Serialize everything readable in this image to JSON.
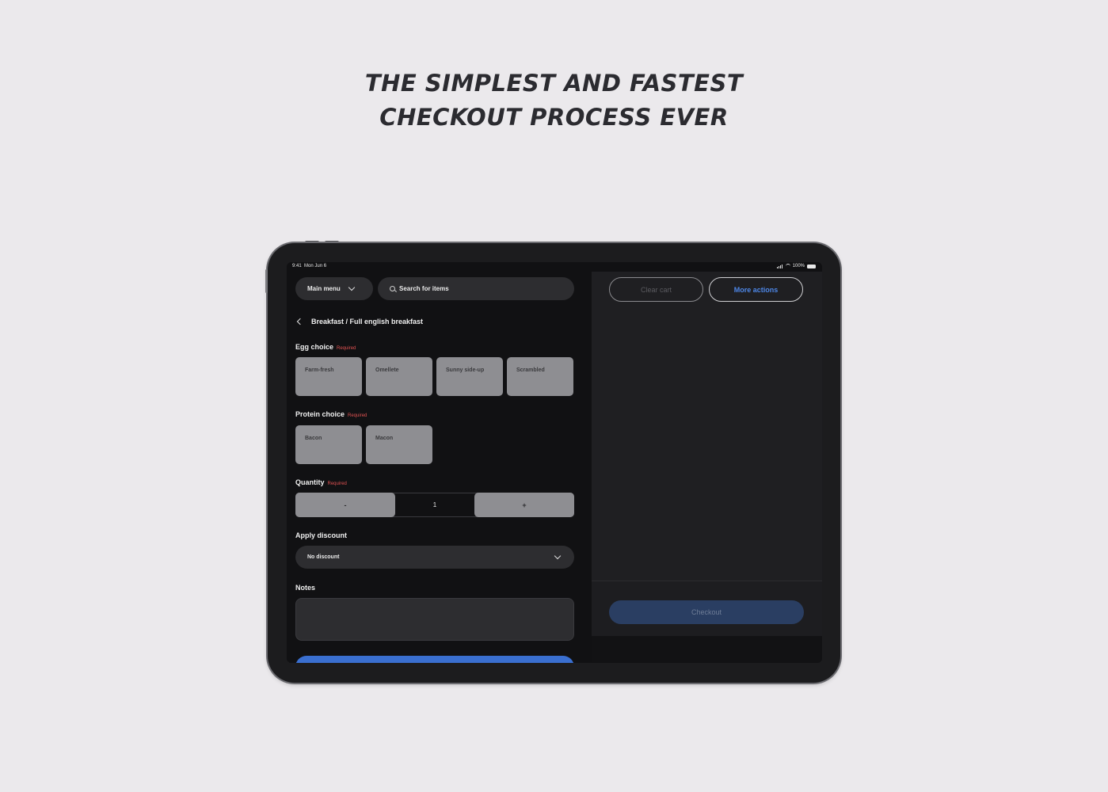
{
  "headline": {
    "line1": "THE SIMPLEST AND FASTEST",
    "line2": "CHECKOUT PROCESS EVER"
  },
  "status_bar": {
    "time": "9:41",
    "date": "Mon Jun 6",
    "battery": "100%"
  },
  "header": {
    "menu_label": "Main menu",
    "search_placeholder": "Search for items"
  },
  "breadcrumb": "Breakfast / Full english breakfast",
  "egg_choice": {
    "label": "Egg choice",
    "required": "Required",
    "options": [
      "Farm-fresh",
      "Omellete",
      "Sunny side-up",
      "Scrambled"
    ]
  },
  "protein_choice": {
    "label": "Protein choice",
    "required": "Required",
    "options": [
      "Bacon",
      "Macon"
    ]
  },
  "quantity": {
    "label": "Quantity",
    "required": "Required",
    "minus": "-",
    "value": "1",
    "plus": "+"
  },
  "discount": {
    "label": "Apply discount",
    "selected": "No discount"
  },
  "notes": {
    "label": "Notes"
  },
  "cart": {
    "clear_label": "Clear cart",
    "more_label": "More actions",
    "checkout_label": "Checkout"
  },
  "colors": {
    "accent": "#3a6fd0",
    "required": "#e05252",
    "option_bg": "#8e8e92"
  }
}
